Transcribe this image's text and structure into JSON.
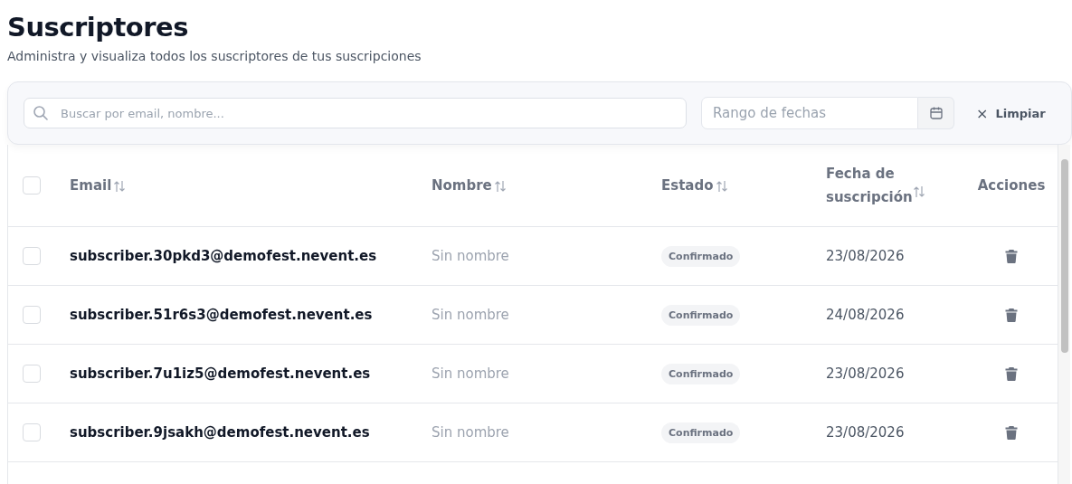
{
  "header": {
    "title": "Suscriptores",
    "subtitle": "Administra y visualiza todos los suscriptores de tus suscripciones"
  },
  "filters": {
    "search": {
      "placeholder": "Buscar por email, nombre..."
    },
    "date_range": {
      "placeholder": "Rango de fechas"
    },
    "clear_button": {
      "icon": "×",
      "label": "Limpiar"
    }
  },
  "table": {
    "select_all": {
      "checked": false
    },
    "columns": [
      {
        "label": "Email",
        "sortable": true
      },
      {
        "label": "Nombre",
        "sortable": true
      },
      {
        "label": "Estado",
        "sortable": true
      },
      {
        "label": "Fecha de suscripción",
        "sortable": true
      },
      {
        "label": "Acciones",
        "sortable": false
      }
    ],
    "rows": [
      {
        "checked": false,
        "email": "subscriber.30pkd3@demofest.nevent.es",
        "name": "Sin nombre",
        "status": "Confirmado",
        "date": "23/08/2026"
      },
      {
        "checked": false,
        "email": "subscriber.51r6s3@demofest.nevent.es",
        "name": "Sin nombre",
        "status": "Confirmado",
        "date": "24/08/2026"
      },
      {
        "checked": false,
        "email": "subscriber.7u1iz5@demofest.nevent.es",
        "name": "Sin nombre",
        "status": "Confirmado",
        "date": "23/08/2026"
      },
      {
        "checked": false,
        "email": "subscriber.9jsakh@demofest.nevent.es",
        "name": "Sin nombre",
        "status": "Confirmado",
        "date": "23/08/2026"
      }
    ]
  }
}
